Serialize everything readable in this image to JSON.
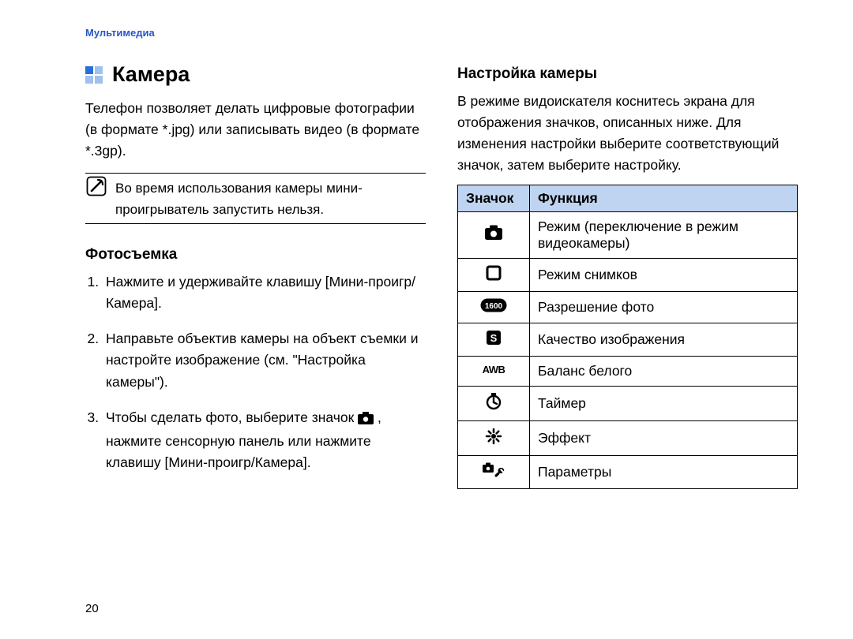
{
  "runningHead": "Мультимедиа",
  "title": "Камера",
  "intro": "Телефон позволяет делать цифровые фотографии (в формате *.jpg) или записывать видео (в формате *.3gp).",
  "note": "Во время использования камеры мини-проигрыватель запустить нельзя.",
  "section1": {
    "heading": "Фотосъемка",
    "step1": "Нажмите и удерживайте клавишу [Мини-проигр/Камера].",
    "step2": "Направьте объектив камеры на объект съемки и настройте изображение (см. \"Настройка камеры\").",
    "step3a": "Чтобы сделать фото, выберите значок ",
    "step3b": ", нажмите сенсорную панель или нажмите клавишу [Мини-проигр/Камера]."
  },
  "section2": {
    "heading": "Настройка камеры",
    "intro": "В режиме видоискателя коснитесь экрана для отображения значков, описанных ниже. Для изменения настройки выберите соответствующий значок, затем выберите настройку.",
    "colIcon": "Значок",
    "colFunc": "Функция",
    "rows": {
      "r1": "Режим (переключение в режим видеокамеры)",
      "r2": "Режим снимков",
      "r3": "Разрешение фото",
      "r4": "Качество изображения",
      "r5": "Баланс белого",
      "r6": "Таймер",
      "r7": "Эффект",
      "r8": "Параметры"
    }
  },
  "pageNumber": "20"
}
